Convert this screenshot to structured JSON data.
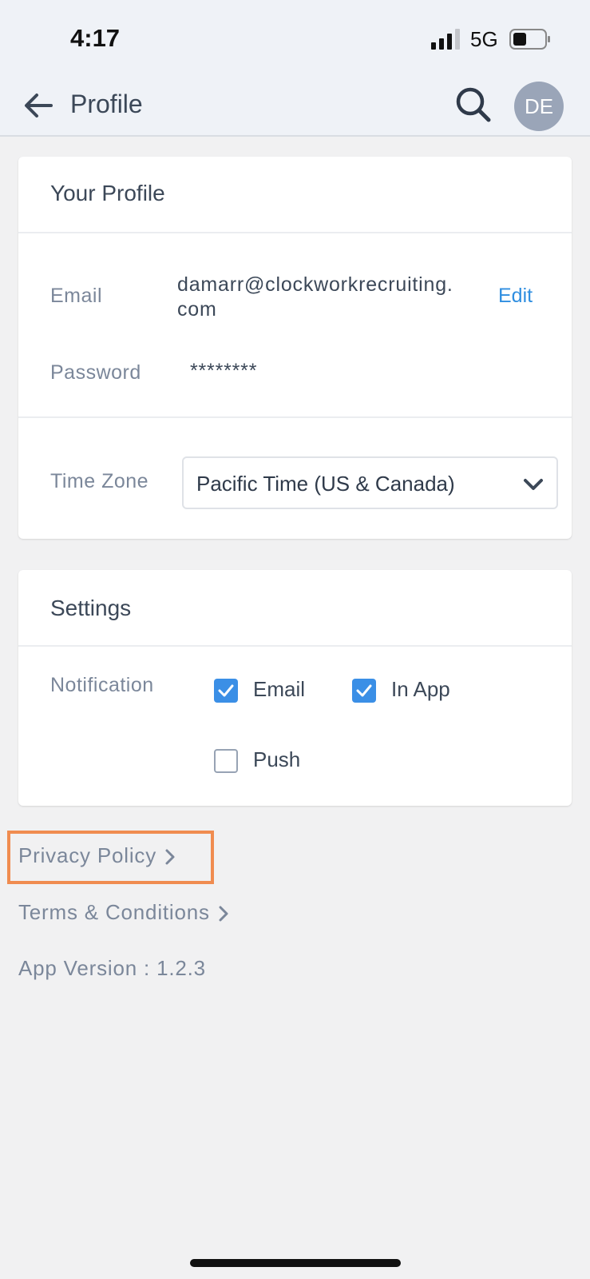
{
  "status_bar": {
    "time": "4:17",
    "network": "5G"
  },
  "header": {
    "title": "Profile",
    "avatar_initials": "DE"
  },
  "profile_card": {
    "title": "Your Profile",
    "email_label": "Email",
    "email_value_line1": "damarr@clockworkrecruiting.",
    "email_value_line2": "com",
    "edit_label": "Edit",
    "password_label": "Password",
    "password_value": "********",
    "timezone_label": "Time Zone",
    "timezone_value": "Pacific Time (US & Canada)"
  },
  "settings_card": {
    "title": "Settings",
    "notification_label": "Notification",
    "options": [
      {
        "label": "Email",
        "checked": true
      },
      {
        "label": "In App",
        "checked": true
      },
      {
        "label": "Push",
        "checked": false
      }
    ]
  },
  "footer": {
    "privacy_policy": "Privacy Policy",
    "terms": "Terms & Conditions",
    "app_version": "App Version : 1.2.3"
  },
  "colors": {
    "accent": "#3b8fe6",
    "link": "#2f8ee0",
    "highlight": "#f08c50",
    "avatar_bg": "#9aa5b8"
  },
  "icons": [
    "back-arrow-icon",
    "search-icon",
    "chevron-down-icon",
    "chevron-right-icon",
    "checkmark-icon",
    "signal-icon",
    "battery-icon"
  ]
}
